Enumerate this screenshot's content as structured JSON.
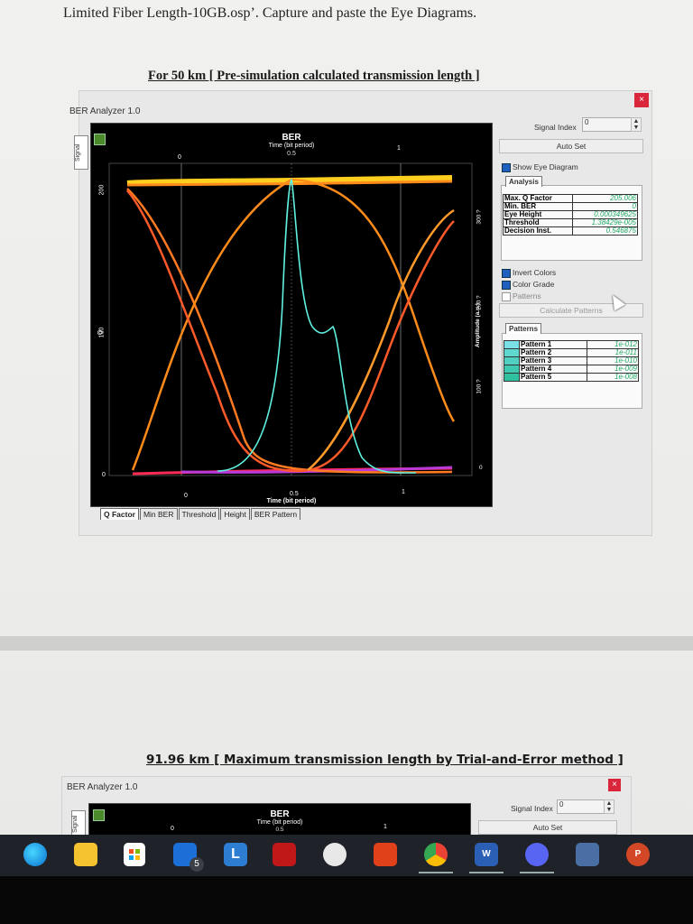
{
  "document": {
    "instruction": "Limited Fiber Length-10GB.osp’. Capture and paste the Eye Diagrams.",
    "heading1": "For 50 km [ Pre-simulation calculated transmission length ]",
    "heading2": "91.96 km [ Maximum transmission length by Trial-and-Error method ]"
  },
  "analyzer": {
    "title": "BER Analyzer 1.0",
    "close": "×",
    "side_tab": "Signal",
    "plot": {
      "title": "BER",
      "subtitle": "Time (bit period)",
      "top_tick": "0.5",
      "top_x_ticks": [
        "0",
        "0.5",
        "1"
      ],
      "bottom_x_ticks": [
        "0",
        "0.5",
        "1"
      ],
      "xlabel": "Time (bit period)",
      "left_label": "Q",
      "left_ticks": [
        "200",
        "100",
        "0"
      ],
      "right_ticks": [
        "300 ?",
        "200 ?",
        "100 ?",
        "0"
      ],
      "right_label": "Amplitude (a.u.)"
    },
    "tabs": [
      "Q Factor",
      "Min BER",
      "Threshold",
      "Height",
      "BER Pattern"
    ],
    "controls": {
      "signal_index_label": "Signal Index",
      "signal_index_value": "0",
      "auto_set": "Auto Set",
      "show_eye": "Show Eye Diagram",
      "analysis_tab": "Analysis",
      "analysis": [
        {
          "label": "Max. Q Factor",
          "value": "205.006"
        },
        {
          "label": "Min. BER",
          "value": "0"
        },
        {
          "label": "Eye Height",
          "value": "0.000349625"
        },
        {
          "label": "Threshold",
          "value": "1.38429e-005"
        },
        {
          "label": "Decision Inst.",
          "value": "0.546875"
        }
      ],
      "invert_colors": "Invert Colors",
      "color_grade": "Color Grade",
      "patterns_chk": "Patterns",
      "calculate_patterns": "Calculate Patterns",
      "patterns_tab": "Patterns",
      "patterns": [
        {
          "label": "Pattern 1",
          "value": "1e-012"
        },
        {
          "label": "Pattern 2",
          "value": "1e-011"
        },
        {
          "label": "Pattern 3",
          "value": "1e-010"
        },
        {
          "label": "Pattern 4",
          "value": "1e-009"
        },
        {
          "label": "Pattern 5",
          "value": "1e-008"
        }
      ]
    }
  },
  "analyzer2": {
    "title": "BER Analyzer 1.0",
    "side_tab": "Signal",
    "plot_title": "BER",
    "plot_subtitle": "Time (bit period)",
    "top_tick": "0.5",
    "x_ticks": [
      "0",
      "1"
    ],
    "signal_index_label": "Signal Index",
    "signal_index_value": "0",
    "auto_set": "Auto Set"
  },
  "taskbar": {
    "mail_badge": "5",
    "icons": [
      "edge-icon",
      "file-explorer-icon",
      "store-icon",
      "mail-icon",
      "l-app-icon",
      "mcafee-icon",
      "xbox-icon",
      "office-icon",
      "chrome-icon",
      "word-icon",
      "discord-icon",
      "widget-icon",
      "powerpoint-icon"
    ]
  },
  "colors": {
    "eye_orange": "#ff8c1a",
    "eye_yellow": "#ffd21a",
    "ber_cyan": "#5ff0e0",
    "baseline_magenta": "#c03cd8"
  }
}
